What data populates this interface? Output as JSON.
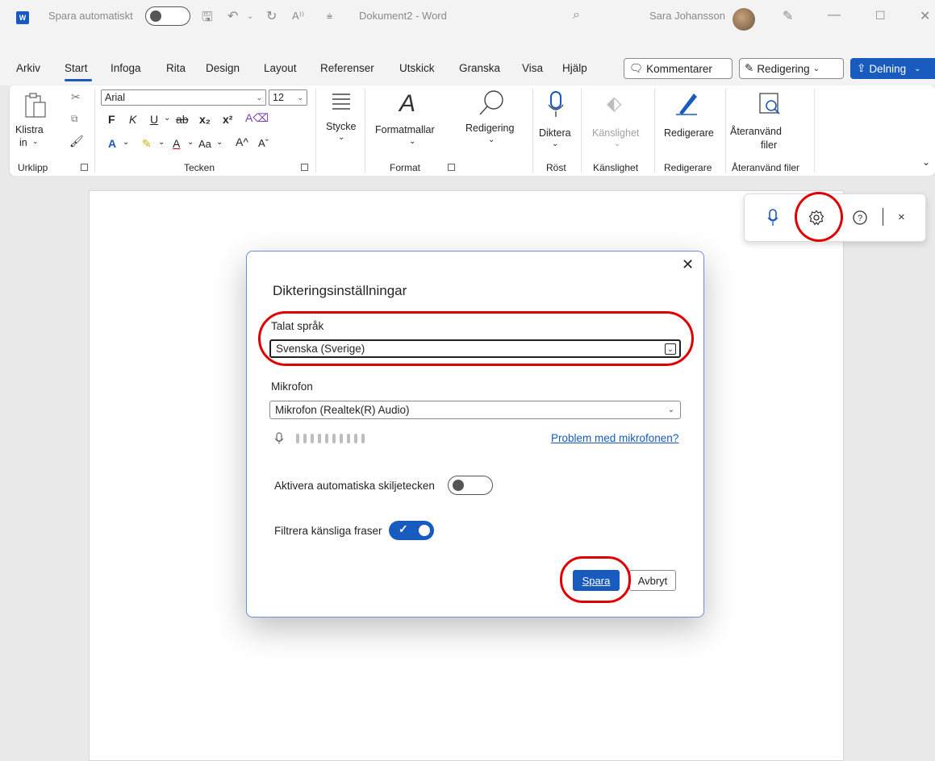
{
  "titlebar": {
    "app_icon": "word-logo",
    "autosave_label": "Spara automatiskt",
    "doc_title": "Dokument2 - Word",
    "user_name": "Sara Johansson"
  },
  "tabs": [
    "Arkiv",
    "Start",
    "Infoga",
    "Rita",
    "Design",
    "Layout",
    "Referenser",
    "Utskick",
    "Granska",
    "Visa",
    "Hjälp"
  ],
  "toolbar_right": {
    "comments": "Kommentarer",
    "editing": "Redigering",
    "share": "Delning"
  },
  "ribbon": {
    "paste_label_1": "Klistra",
    "paste_label_2": "in",
    "font_name": "Arial",
    "font_size": "12",
    "bold": "F",
    "italic": "K",
    "underline": "U",
    "paragraph": "Stycke",
    "styles": "Formatmallar",
    "editing": "Redigering",
    "dictate": "Diktera",
    "sensitivity": "Känslighet",
    "editor": "Redigerare",
    "reuse_1": "Återanvänd",
    "reuse_2": "filer",
    "groups": {
      "clipboard": "Urklipp",
      "font": "Tecken",
      "format": "Format",
      "voice": "Röst",
      "sensitivity": "Känslighet",
      "editor": "Redigerare",
      "reuse": "Återanvänd filer"
    }
  },
  "dialog": {
    "title": "Dikteringsinställningar",
    "language_label": "Talat språk",
    "language_value": "Svenska (Sverige)",
    "mic_label": "Mikrofon",
    "mic_value": "Mikrofon (Realtek(R) Audio)",
    "mic_problem_link": "Problem med mikrofonen?",
    "auto_punct_label": "Aktivera automatiska skiljetecken",
    "auto_punct_on": false,
    "filter_label": "Filtrera känsliga fraser",
    "filter_on": true,
    "save_button": "Spara",
    "cancel_button": "Avbryt"
  },
  "colors": {
    "accent": "#185abd",
    "annotation": "#e00000"
  }
}
